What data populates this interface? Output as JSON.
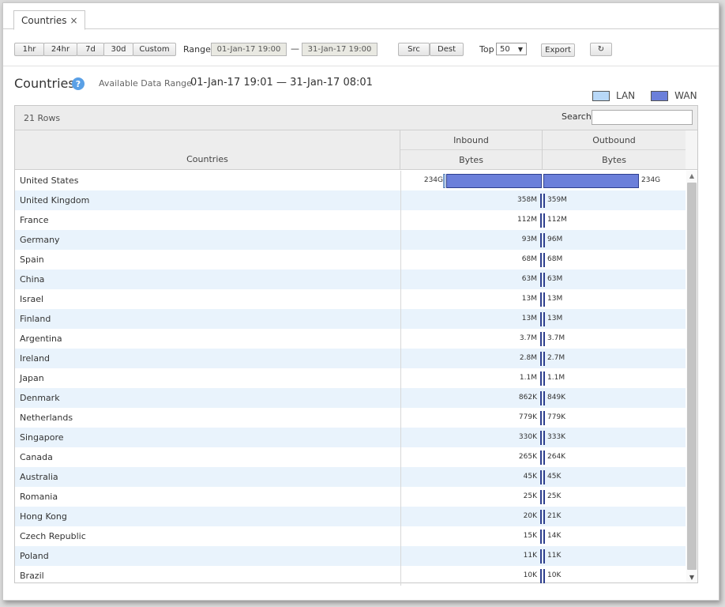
{
  "tab": {
    "label": "Countries",
    "close": "×"
  },
  "toolbar": {
    "time_buttons": [
      "1hr",
      "24hr",
      "7d",
      "30d",
      "Custom"
    ],
    "active_button": "30d",
    "range_label": "Range",
    "range_start": "01-Jan-17 19:00",
    "range_sep": "—",
    "range_end": "31-Jan-17 19:00",
    "src_label": "Src",
    "dest_label": "Dest",
    "top_label": "Top",
    "top_value": "50",
    "export_label": "Export",
    "refresh_icon": "↻"
  },
  "header": {
    "title": "Countries",
    "help": "?",
    "available_label": "Available Data Range",
    "available_value": "01-Jan-17 19:01 — 31-Jan-17 08:01"
  },
  "legend": {
    "lan_label": "LAN",
    "wan_label": "WAN",
    "lan_color": "#b8d8f8",
    "wan_color": "#6b7fda"
  },
  "grid": {
    "row_count": "21 Rows",
    "search_label": "Search",
    "search_value": "",
    "col_countries": "Countries",
    "col_inbound": "Inbound",
    "col_outbound": "Outbound",
    "col_bytes_in": "Bytes",
    "col_bytes_out": "Bytes",
    "rows": [
      {
        "country": "United States",
        "in": "234G",
        "out": "234G",
        "in_bytes": 234000000000,
        "out_bytes": 234000000000
      },
      {
        "country": "United Kingdom",
        "in": "358M",
        "out": "359M",
        "in_bytes": 358000000,
        "out_bytes": 359000000
      },
      {
        "country": "France",
        "in": "112M",
        "out": "112M",
        "in_bytes": 112000000,
        "out_bytes": 112000000
      },
      {
        "country": "Germany",
        "in": "93M",
        "out": "96M",
        "in_bytes": 93000000,
        "out_bytes": 96000000
      },
      {
        "country": "Spain",
        "in": "68M",
        "out": "68M",
        "in_bytes": 68000000,
        "out_bytes": 68000000
      },
      {
        "country": "China",
        "in": "63M",
        "out": "63M",
        "in_bytes": 63000000,
        "out_bytes": 63000000
      },
      {
        "country": "Israel",
        "in": "13M",
        "out": "13M",
        "in_bytes": 13000000,
        "out_bytes": 13000000
      },
      {
        "country": "Finland",
        "in": "13M",
        "out": "13M",
        "in_bytes": 13000000,
        "out_bytes": 13000000
      },
      {
        "country": "Argentina",
        "in": "3.7M",
        "out": "3.7M",
        "in_bytes": 3700000,
        "out_bytes": 3700000
      },
      {
        "country": "Ireland",
        "in": "2.8M",
        "out": "2.7M",
        "in_bytes": 2800000,
        "out_bytes": 2700000
      },
      {
        "country": "Japan",
        "in": "1.1M",
        "out": "1.1M",
        "in_bytes": 1100000,
        "out_bytes": 1100000
      },
      {
        "country": "Denmark",
        "in": "862K",
        "out": "849K",
        "in_bytes": 862000,
        "out_bytes": 849000
      },
      {
        "country": "Netherlands",
        "in": "779K",
        "out": "779K",
        "in_bytes": 779000,
        "out_bytes": 779000
      },
      {
        "country": "Singapore",
        "in": "330K",
        "out": "333K",
        "in_bytes": 330000,
        "out_bytes": 333000
      },
      {
        "country": "Canada",
        "in": "265K",
        "out": "264K",
        "in_bytes": 265000,
        "out_bytes": 264000
      },
      {
        "country": "Australia",
        "in": "45K",
        "out": "45K",
        "in_bytes": 45000,
        "out_bytes": 45000
      },
      {
        "country": "Romania",
        "in": "25K",
        "out": "25K",
        "in_bytes": 25000,
        "out_bytes": 25000
      },
      {
        "country": "Hong Kong",
        "in": "20K",
        "out": "21K",
        "in_bytes": 20000,
        "out_bytes": 21000
      },
      {
        "country": "Czech Republic",
        "in": "15K",
        "out": "14K",
        "in_bytes": 15000,
        "out_bytes": 14000
      },
      {
        "country": "Poland",
        "in": "11K",
        "out": "11K",
        "in_bytes": 11000,
        "out_bytes": 11000
      },
      {
        "country": "Brazil",
        "in": "10K",
        "out": "10K",
        "in_bytes": 10000,
        "out_bytes": 10000
      }
    ]
  },
  "scrollbar": {
    "up": "▲",
    "down": "▼"
  }
}
